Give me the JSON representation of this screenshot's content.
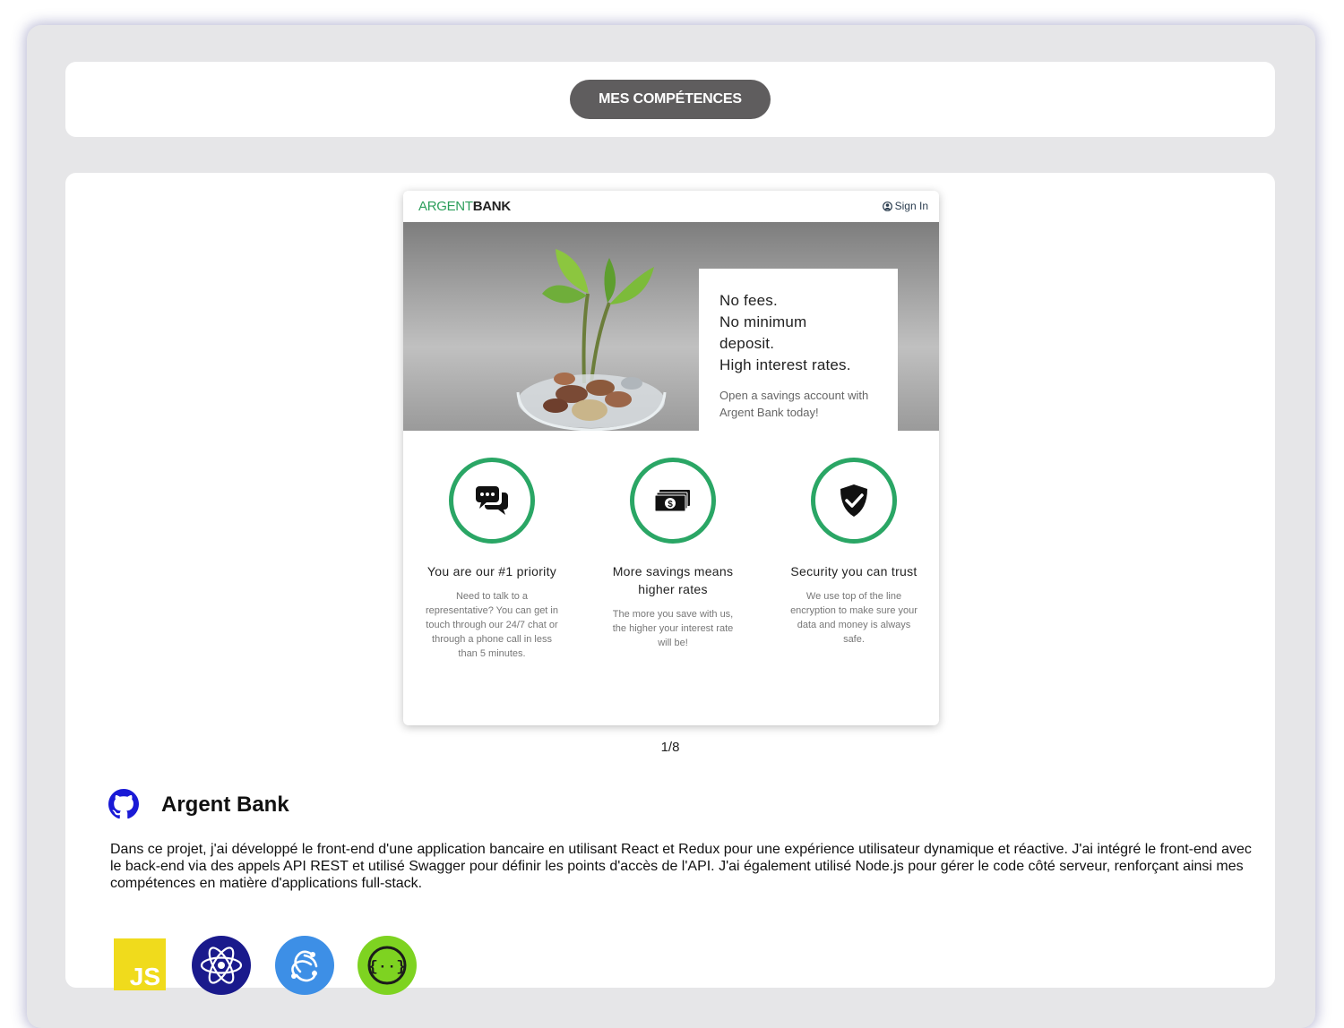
{
  "header": {
    "skills_button": "MES COMPÉTENCES"
  },
  "preview": {
    "logo_green": "ARGENT",
    "logo_dark": "BANK",
    "sign_in": "Sign In",
    "hero_subtitles": [
      "No fees.",
      "No minimum",
      "deposit.",
      "High interest rates."
    ],
    "hero_text": "Open a savings account with Argent Bank today!",
    "features": [
      {
        "icon": "chat-icon",
        "title": "You are our #1 priority",
        "text": "Need to talk to a representative? You can get in touch through our 24/7 chat or through a phone call in less than 5 minutes."
      },
      {
        "icon": "money-icon",
        "title": "More savings means higher rates",
        "text": "The more you save with us, the higher your interest rate will be!"
      },
      {
        "icon": "shield-icon",
        "title": "Security you can trust",
        "text": "We use top of the line encryption to make sure your data and money is always safe."
      }
    ],
    "accent": "#2aa665"
  },
  "pager": "1/8",
  "project": {
    "title": "Argent Bank",
    "description": "Dans ce projet, j'ai développé le front-end d'une application bancaire en utilisant React et Redux pour une expérience utilisateur dynamique et réactive. J'ai intégré le front-end avec le back-end via des appels API REST et utilisé Swagger pour définir les points d'accès de l'API. J'ai également utilisé Node.js pour gérer le code côté serveur, renforçant ainsi mes compétences en matière d'applications full-stack.",
    "tech_icons": [
      "javascript-icon",
      "react-icon",
      "redux-icon",
      "swagger-icon"
    ],
    "js_label": "JS"
  }
}
